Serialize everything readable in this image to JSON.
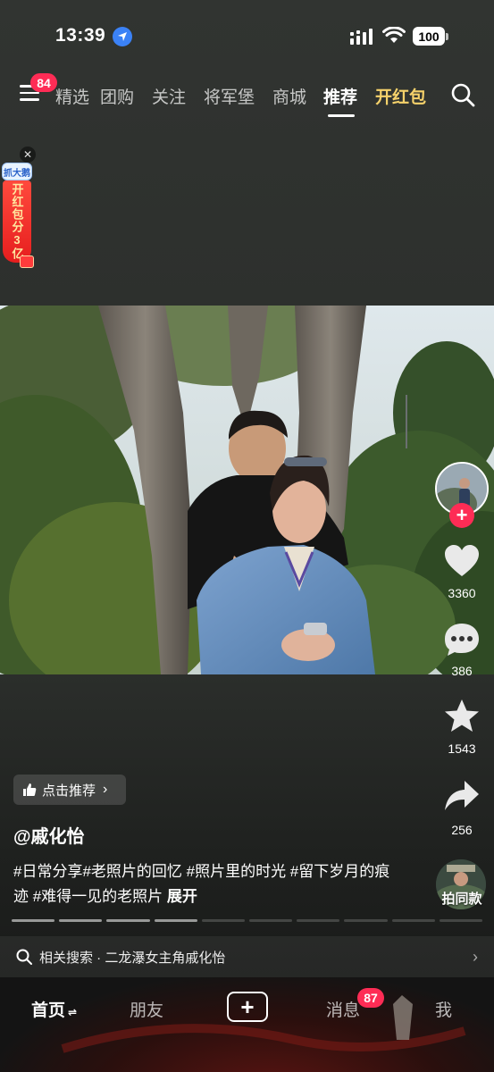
{
  "status": {
    "time": "13:39",
    "battery": "100"
  },
  "nav": {
    "menu_badge": "84",
    "tabs": [
      {
        "label": "精选"
      },
      {
        "label": "团购"
      },
      {
        "label": "关注"
      },
      {
        "label": "将军堡"
      },
      {
        "label": "商城"
      },
      {
        "label": "推荐"
      },
      {
        "label": "开红包"
      }
    ],
    "active_tab": "推荐"
  },
  "promo": {
    "top_text": "抓大鹅",
    "body_text": "开红包分3亿"
  },
  "rail": {
    "like_count": "3360",
    "comment_count": "386",
    "favorite_count": "1543",
    "share_count": "256",
    "music_label": "拍同款"
  },
  "post": {
    "recommend_label": "点击推荐",
    "author": "@戚化怡",
    "caption": "#日常分享#老照片的回忆 #照片里的时光 #留下岁月的痕迹 #难得一见的老照片",
    "expand": "展开"
  },
  "progress": {
    "segments": 10,
    "completed": 4
  },
  "related_search": {
    "text": "相关搜索 · 二龙瀑女主角戚化怡"
  },
  "tabbar": {
    "home": "首页",
    "friends": "朋友",
    "messages": "消息",
    "messages_badge": "87",
    "me": "我"
  },
  "colors": {
    "accent": "#fe2c55",
    "gold": "#f6d26b"
  }
}
